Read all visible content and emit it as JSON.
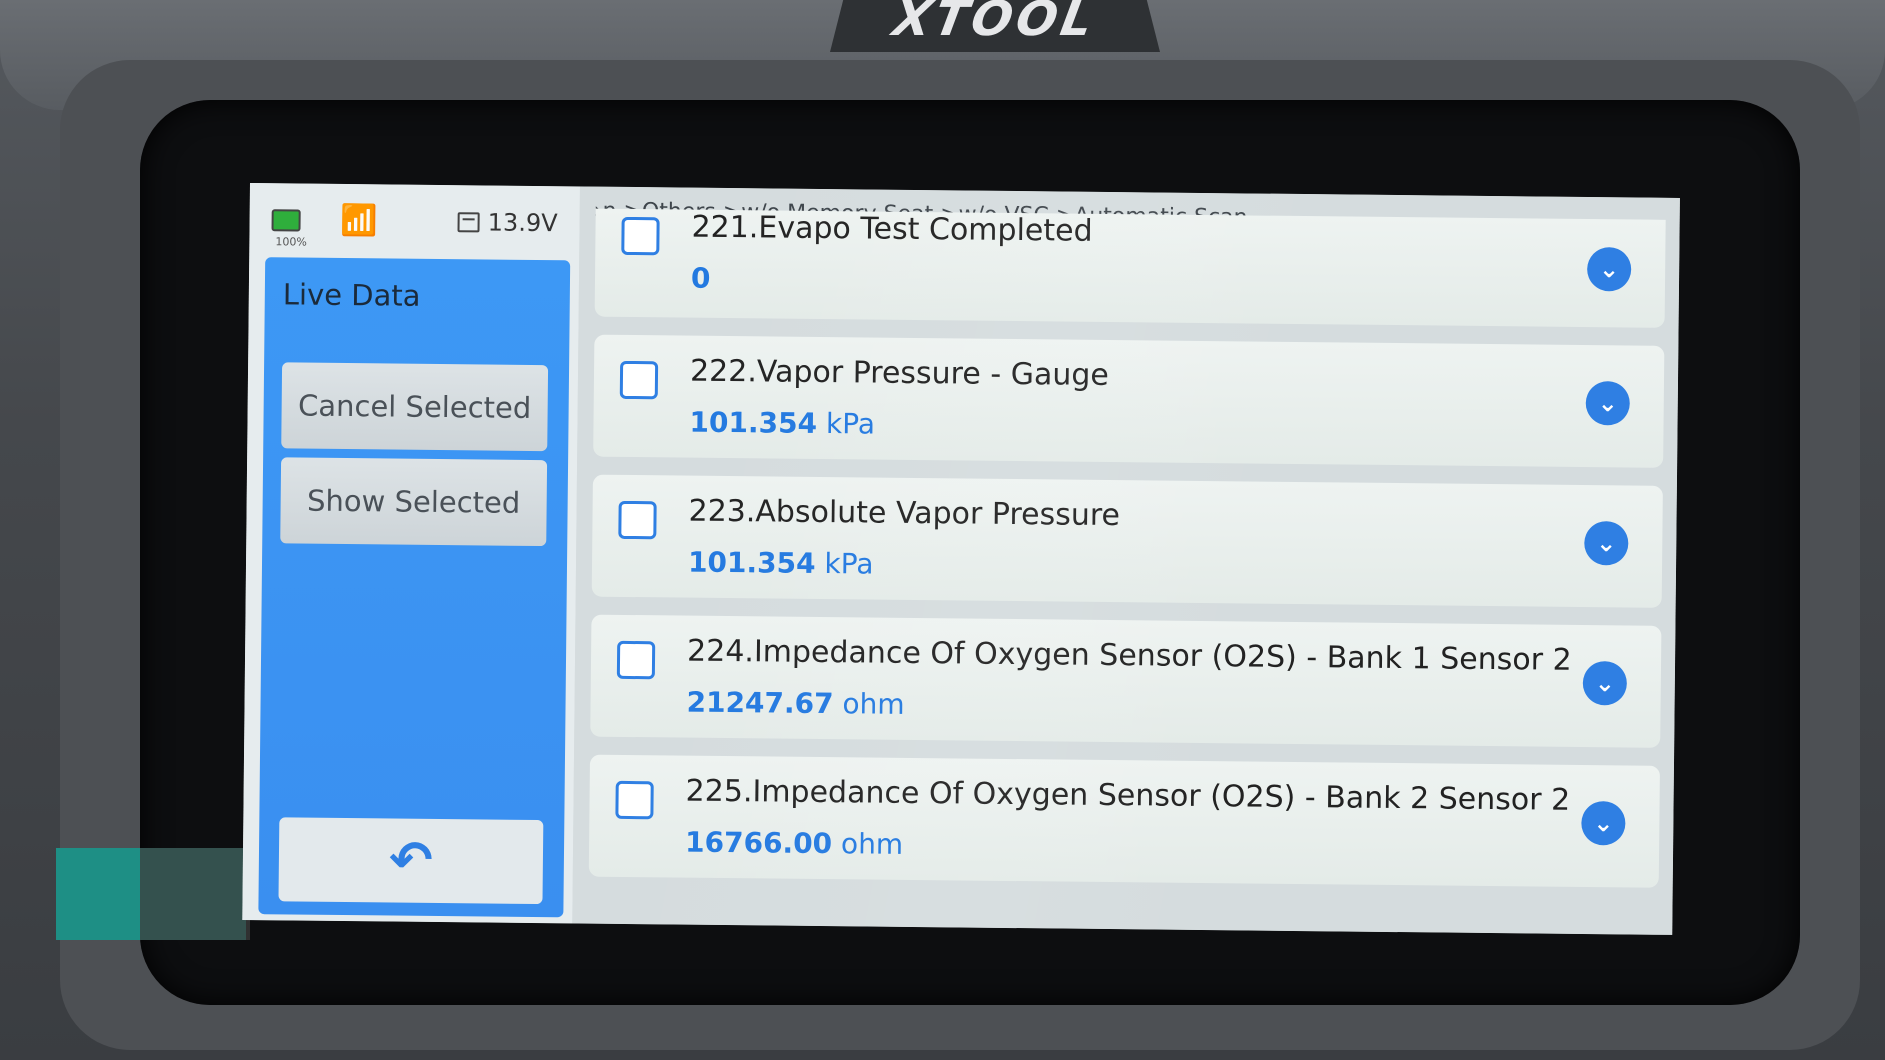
{
  "device": {
    "brand": "XTOOL"
  },
  "status": {
    "battery_pct": "100%",
    "voltage": "13.9V",
    "battery_icon": "battery-icon",
    "wifi_icon": "wifi-icon",
    "voltage_icon": "calendar-icon"
  },
  "sidebar": {
    "title": "Live Data",
    "cancel_label": "Cancel Selected",
    "show_label": "Show Selected",
    "back_icon": "back-arrow-icon"
  },
  "breadcrumb": "›n >Others >w/o Memory Seat >w/o VSC >Automatic Scan",
  "rows": [
    {
      "name": "221.Evapo Test Completed",
      "value": "0",
      "unit": ""
    },
    {
      "name": "222.Vapor Pressure - Gauge",
      "value": "101.354",
      "unit": "kPa"
    },
    {
      "name": "223.Absolute Vapor Pressure",
      "value": "101.354",
      "unit": "kPa"
    },
    {
      "name": "224.Impedance Of Oxygen Sensor (O2S) - Bank 1 Sensor 2",
      "value": "21247.67",
      "unit": "ohm"
    },
    {
      "name": "225.Impedance Of Oxygen Sensor (O2S) - Bank 2 Sensor 2",
      "value": "16766.00",
      "unit": "ohm"
    }
  ],
  "colors": {
    "accent": "#2f7fe3",
    "panel": "#3a8ff0"
  }
}
